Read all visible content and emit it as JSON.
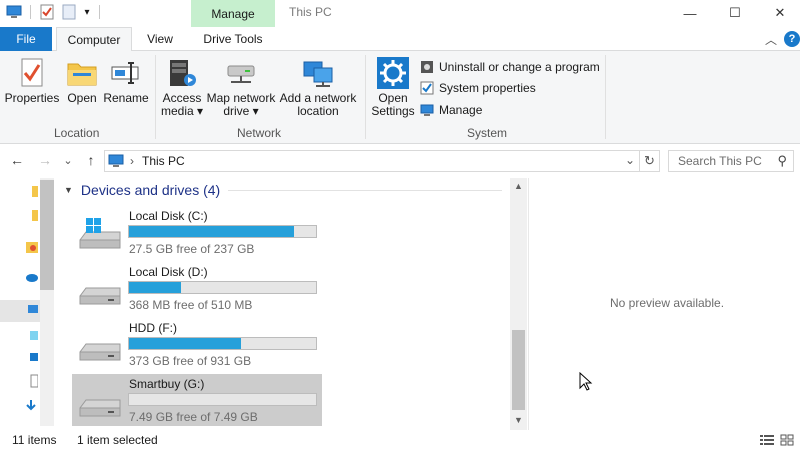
{
  "titlebar": {
    "manage_tab": "Manage",
    "window_title": "This PC",
    "minimize_glyph": "—",
    "maximize_glyph": "☐",
    "close_glyph": "✕"
  },
  "tabs": {
    "file": "File",
    "computer": "Computer",
    "view": "View",
    "drive_tools": "Drive Tools",
    "collapse_glyph": "︿",
    "help_glyph": "?"
  },
  "ribbon": {
    "location": {
      "group_label": "Location",
      "properties": "Properties",
      "open": "Open",
      "rename": "Rename"
    },
    "network": {
      "group_label": "Network",
      "access_media_1": "Access",
      "access_media_2": "media ▾",
      "map_drive_1": "Map network",
      "map_drive_2": "drive ▾",
      "add_location_1": "Add a network",
      "add_location_2": "location"
    },
    "system": {
      "group_label": "System",
      "open_settings_1": "Open",
      "open_settings_2": "Settings",
      "uninstall": "Uninstall or change a program",
      "system_properties": "System properties",
      "manage": "Manage"
    }
  },
  "navigation": {
    "back_glyph": "←",
    "forward_glyph": "→",
    "recent_glyph": "⌄",
    "up_glyph": "↑",
    "breadcrumb_sep": "›",
    "address": "This PC",
    "dropdown_glyph": "⌄",
    "refresh_glyph": "↻",
    "search_placeholder": "Search This PC",
    "search_glyph": "⚲"
  },
  "content": {
    "group_title": "Devices and drives (4)",
    "drives": [
      {
        "name": "Local Disk (C:)",
        "free_text": "27.5 GB free of 237 GB",
        "used_fraction": 0.884,
        "icon": "windows-drive-icon"
      },
      {
        "name": "Local Disk (D:)",
        "free_text": "368 MB free of 510 MB",
        "used_fraction": 0.278,
        "icon": "hard-drive-icon"
      },
      {
        "name": "HDD (F:)",
        "free_text": "373 GB free of 931 GB",
        "used_fraction": 0.599,
        "icon": "hard-drive-icon"
      },
      {
        "name": "Smartbuy (G:)",
        "free_text": "7.49 GB free of 7.49 GB",
        "used_fraction": 0.0,
        "icon": "hard-drive-icon",
        "selected": true
      }
    ]
  },
  "preview": {
    "text": "No preview available."
  },
  "status": {
    "item_count": "11 items",
    "selection": "1 item selected"
  },
  "colors": {
    "accent": "#1979ca",
    "manage_tab": "#c6efce",
    "bar_fill": "#26a0da",
    "selection": "#cccccc"
  }
}
